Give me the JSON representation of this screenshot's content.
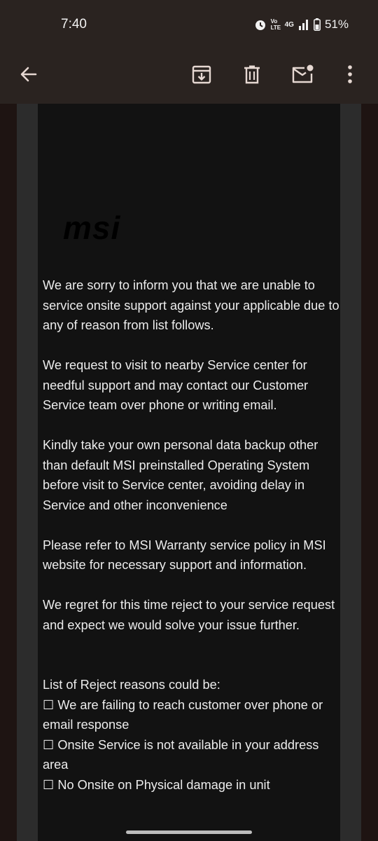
{
  "status_bar": {
    "time": "7:40",
    "volte": "Vo LTE",
    "network": "4G",
    "battery": "51%"
  },
  "toolbar": {
    "back_icon": "arrow-left-icon",
    "archive_icon": "archive-icon",
    "delete_icon": "trash-icon",
    "mark_unread_icon": "mail-unread-icon",
    "more_icon": "more-vertical-icon"
  },
  "email": {
    "logo_text": "msi",
    "paragraphs": [
      "We are sorry to inform you that we are unable to service onsite support against your applicable due to any of reason from list follows.",
      "We request to visit to nearby Service center for needful support and may contact our Customer Service team over phone or writing email.",
      "Kindly take your own personal data backup other than default MSI preinstalled Operating System before visit to Service center, avoiding delay in Service and other inconvenience",
      "Please refer to MSI Warranty service policy in MSI website for necessary support and information.",
      "We regret for this time reject to your service request and expect we would solve your issue further."
    ],
    "reasons_heading": "List of Reject reasons could be:",
    "reasons": [
      "☐ We are failing to reach customer over phone or email response",
      "☐ Onsite Service is not available in your address area",
      "☐ No Onsite on Physical damage in unit"
    ]
  }
}
